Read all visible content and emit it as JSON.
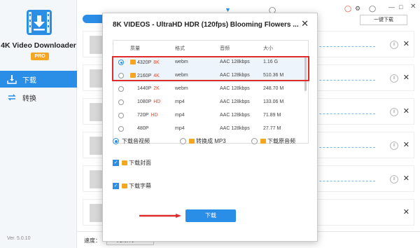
{
  "app": {
    "name": "4K Video Downloader",
    "badge": "PRO",
    "version": "Ver. 5.0.10"
  },
  "sidebar": {
    "items": [
      {
        "label": "下载",
        "icon": "download-tray-icon"
      },
      {
        "label": "转换",
        "icon": "convert-arrows-icon"
      }
    ]
  },
  "topbar": {
    "paste_label": "一键下载",
    "colors": {
      "accent": "#2b8ee6"
    }
  },
  "bottom": {
    "speed_label": "速度：",
    "speed_value": "无限制"
  },
  "dialog": {
    "title": "8K VIDEOS - UltraHD HDR (120fps)  Blooming Flowers ...",
    "columns": [
      "质量",
      "格式",
      "音频",
      "大小"
    ],
    "rows": [
      {
        "quality": "4320P",
        "tag": "8K",
        "format": "webm",
        "audio": "AAC 128kbps",
        "size": "1.16 G",
        "selected": true,
        "premium": true
      },
      {
        "quality": "2160P",
        "tag": "4K",
        "format": "webm",
        "audio": "AAC 128kbps",
        "size": "510.36 M",
        "selected": false,
        "premium": true
      },
      {
        "quality": "1440P",
        "tag": "2K",
        "format": "webm",
        "audio": "AAC 128kbps",
        "size": "248.70 M",
        "selected": false,
        "premium": false
      },
      {
        "quality": "1080P",
        "tag": "HD",
        "format": "mp4",
        "audio": "AAC 128kbps",
        "size": "133.06 M",
        "selected": false,
        "premium": false
      },
      {
        "quality": "720P",
        "tag": "HD",
        "format": "mp4",
        "audio": "AAC 128kbps",
        "size": "71.89 M",
        "selected": false,
        "premium": false
      },
      {
        "quality": "480P",
        "tag": "",
        "format": "mp4",
        "audio": "AAC 128kbps",
        "size": "27.77 M",
        "selected": false,
        "premium": false
      }
    ],
    "mode_options": [
      "下载音视频",
      "转换成 MP3",
      "下载原音频"
    ],
    "checkboxes": [
      "下载封面",
      "下载字幕"
    ],
    "download_label": "下载",
    "colors": {
      "highlight_box": "#e02b2b",
      "tag": "#e04a2e",
      "premium": "#f4a623"
    }
  }
}
